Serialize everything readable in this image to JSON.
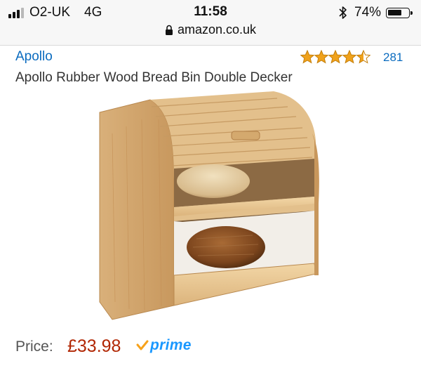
{
  "status": {
    "carrier": "O2-UK",
    "network": "4G",
    "time": "11:58",
    "battery_percent": "74%",
    "battery_level": 0.74,
    "signal_bars": 3,
    "icons": [
      "signal-icon",
      "bluetooth-icon",
      "battery-icon"
    ]
  },
  "browser": {
    "url": "amazon.co.uk",
    "icon": "lock-icon"
  },
  "product": {
    "brand": "Apollo",
    "rating": 4.5,
    "review_count": "281",
    "title": "Apollo Rubber Wood Bread Bin Double Decker",
    "price_label": "Price:",
    "price": "£33.98",
    "prime_label": "prime",
    "colors": {
      "link": "#0a6bbf",
      "price": "#b12704",
      "star": "#f0a21b",
      "prime": "#1a98ff"
    }
  }
}
